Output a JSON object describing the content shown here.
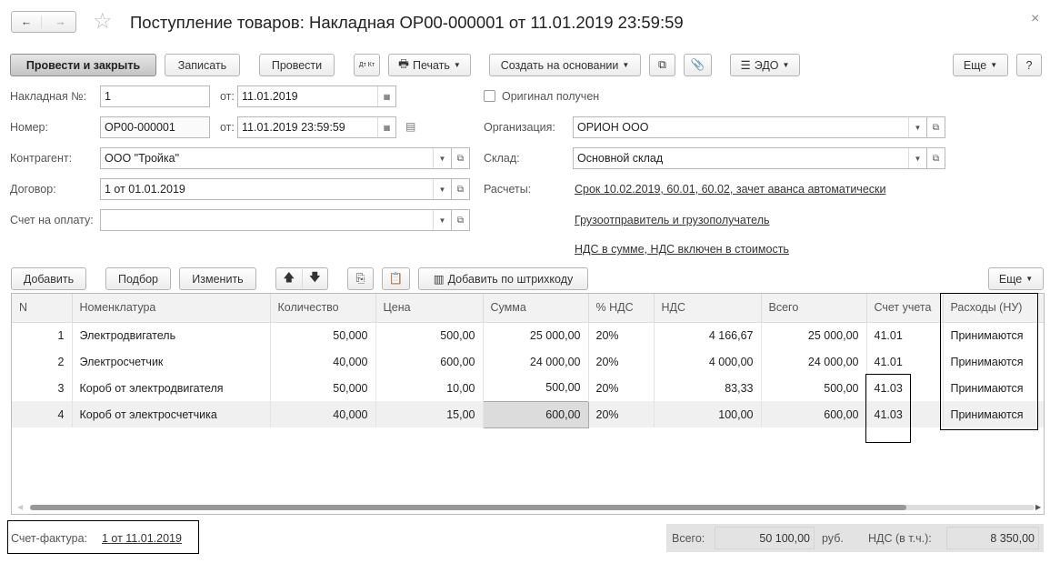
{
  "header": {
    "title": "Поступление товаров: Накладная ОР00-000001 от 11.01.2019 23:59:59",
    "back": "←",
    "forward": "→",
    "star": "☆",
    "close": "×"
  },
  "toolbar": {
    "post_close": "Провести и закрыть",
    "save": "Записать",
    "post": "Провести",
    "dtkt": "Дт Кт",
    "print": "Печать",
    "create_based": "Создать на основании",
    "edo": "ЭДО",
    "more": "Еще",
    "help": "?"
  },
  "form": {
    "invoice_no_label": "Накладная №:",
    "invoice_no": "1",
    "from_label": "от:",
    "invoice_date": "11.01.2019",
    "original_label": "Оригинал получен",
    "number_label": "Номер:",
    "number": "ОР00-000001",
    "number_date": "11.01.2019 23:59:59",
    "org_label": "Организация:",
    "org": "ОРИОН ООО",
    "contractor_label": "Контрагент:",
    "contractor": "ООО \"Тройка\"",
    "warehouse_label": "Склад:",
    "warehouse": "Основной склад",
    "contract_label": "Договор:",
    "contract": "1 от 01.01.2019",
    "settlements_label": "Расчеты:",
    "settlements": "Срок 10.02.2019, 60.01, 60.02, зачет аванса автоматически",
    "payment_label": "Счет на оплату:",
    "payment": "",
    "shipper": "Грузоотправитель и грузополучатель",
    "vat": "НДС в сумме, НДС включен в стоимость"
  },
  "table_toolbar": {
    "add": "Добавить",
    "pick": "Подбор",
    "edit": "Изменить",
    "barcode": "Добавить по штрихкоду",
    "more": "Еще"
  },
  "table": {
    "columns": [
      "N",
      "Номенклатура",
      "Количество",
      "Цена",
      "Сумма",
      "% НДС",
      "НДС",
      "Всего",
      "Счет учета",
      "Расходы (НУ)"
    ],
    "rows": [
      [
        "1",
        "Электродвигатель",
        "50,000",
        "500,00",
        "25 000,00",
        "20%",
        "4 166,67",
        "25 000,00",
        "41.01",
        "Принимаются"
      ],
      [
        "2",
        "Электросчетчик",
        "40,000",
        "600,00",
        "24 000,00",
        "20%",
        "4 000,00",
        "24 000,00",
        "41.01",
        "Принимаются"
      ],
      [
        "3",
        "Короб от электродвигателя",
        "50,000",
        "10,00",
        "500,00",
        "20%",
        "83,33",
        "500,00",
        "41.03",
        "Принимаются"
      ],
      [
        "4",
        "Короб от электросчетчика",
        "40,000",
        "15,00",
        "600,00",
        "20%",
        "100,00",
        "600,00",
        "41.03",
        "Принимаются"
      ]
    ]
  },
  "footer": {
    "invoice_label": "Счет-фактура:",
    "invoice_link": "1 от 11.01.2019",
    "total_label": "Всего:",
    "total": "50 100,00",
    "currency": "руб.",
    "vat_label": "НДС (в т.ч.):",
    "vat": "8 350,00"
  }
}
